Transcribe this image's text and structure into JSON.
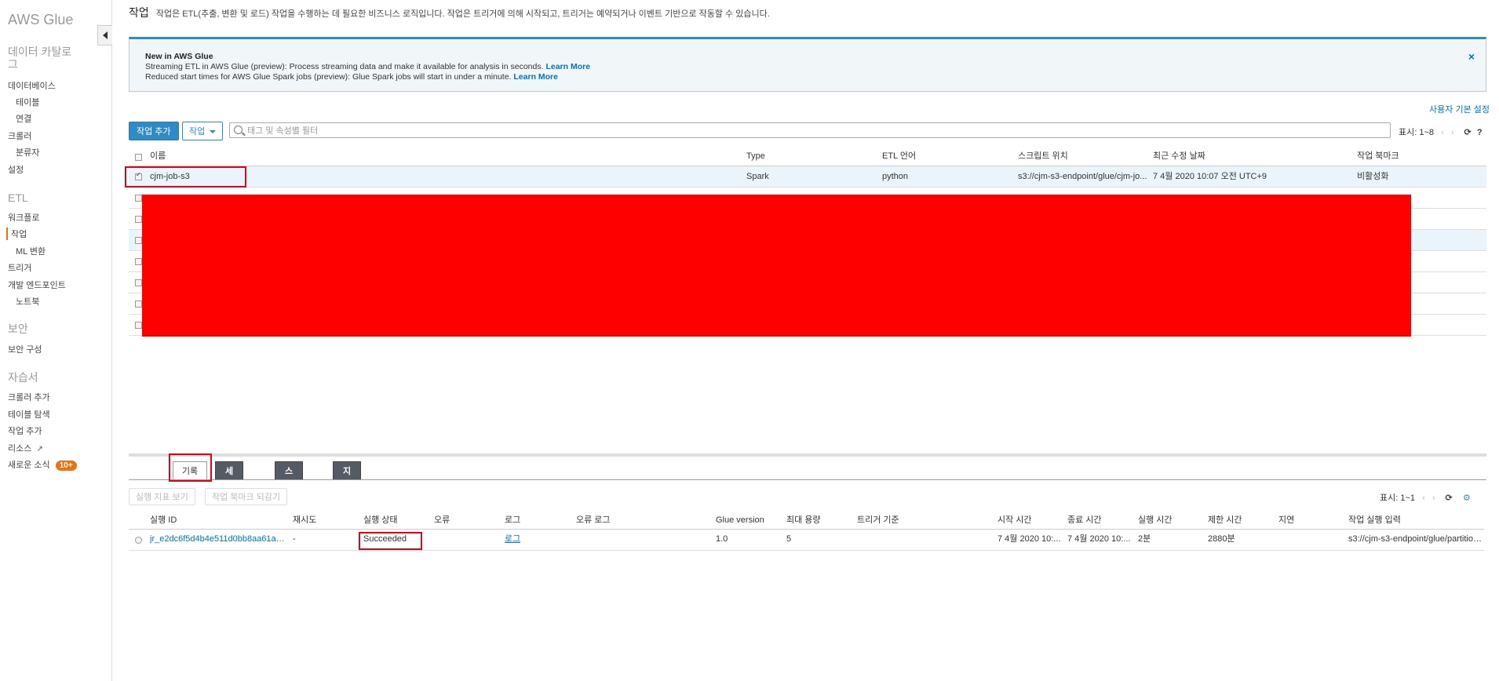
{
  "sidebar": {
    "brand": "AWS Glue",
    "catalog_heading": "데이터 카탈로그",
    "items_catalog": [
      "데이터베이스",
      "테이블",
      "연결",
      "크롤러",
      "분류자",
      "설정"
    ],
    "etl_heading": "ETL",
    "items_etl": [
      "워크플로",
      "작업",
      "ML 변환",
      "트리거",
      "개발 엔드포인트",
      "노트북"
    ],
    "security_heading": "보안",
    "items_security": [
      "보안 구성"
    ],
    "tutorial_heading": "자습서",
    "items_tutorial": [
      "크롤러 추가",
      "테이블 탐색",
      "작업 추가",
      "리소스",
      "새로운 소식"
    ],
    "news_badge": "10+"
  },
  "header": {
    "title": "작업",
    "description": "작업은 ETL(추출, 변환 및 로드) 작업을 수행하는 데 필요한 비즈니스 로직입니다. 작업은 트리거에 의해 시작되고, 트리거는 예약되거나 이벤트 기반으로 작동할 수 있습니다."
  },
  "notice": {
    "title": "New in AWS Glue",
    "line1": "Streaming ETL in AWS Glue (preview): Process streaming data and make it available for analysis in seconds.",
    "line2": "Reduced start times for AWS Glue Spark jobs (preview): Glue Spark jobs will start in under a minute.",
    "link": "Learn More",
    "close": "×"
  },
  "user_prefs": "사용자 기본 설정",
  "toolbar": {
    "add_job": "작업 추가",
    "action": "작업",
    "filter_placeholder": "태그 및 속성별 필터",
    "pagination": "표시: 1~8"
  },
  "jobs_table": {
    "headers": [
      "이름",
      "Type",
      "ETL 언어",
      "스크립트 위치",
      "최근 수정 날짜",
      "작업 북마크"
    ],
    "selected_row": [
      "cjm-job-s3",
      "Spark",
      "python",
      "s3://cjm-s3-endpoint/glue/cjm-jo...",
      "7 4월 2020 10:07 오전 UTC+9",
      "비활성화"
    ]
  },
  "detail_tabs": [
    "기록",
    "세부 정보",
    "스크립트",
    "지표"
  ],
  "history_toolbar": {
    "view_metrics": "실행 지표 보기",
    "rewind_bookmark": "작업 북마크 되감기",
    "pagination": "표시: 1~1"
  },
  "runs_table": {
    "headers": [
      "실행 ID",
      "재시도",
      "실행 상태",
      "오류",
      "로그",
      "오류 로그",
      "Glue version",
      "최대 용량",
      "트리거 기준",
      "시작 시간",
      "종료 시간",
      "실행 시간",
      "제한 시간",
      "지연",
      "작업 실행 입력"
    ],
    "row": [
      "jr_e2dc6f5d4b4e511d0bb8aa61a5...",
      "-",
      "Succeeded",
      "",
      "로그",
      "",
      "1.0",
      "5",
      "",
      "7 4월 2020 10:...",
      "7 4월 2020 10:...",
      "2분",
      "2880분",
      "",
      "s3://cjm-s3-endpoint/glue/partitionl..."
    ]
  },
  "colors": {
    "accent": "#2e8bc6",
    "active_marker": "#ec7211",
    "highlight": "#e2001a",
    "redaction": "#ff0000"
  }
}
